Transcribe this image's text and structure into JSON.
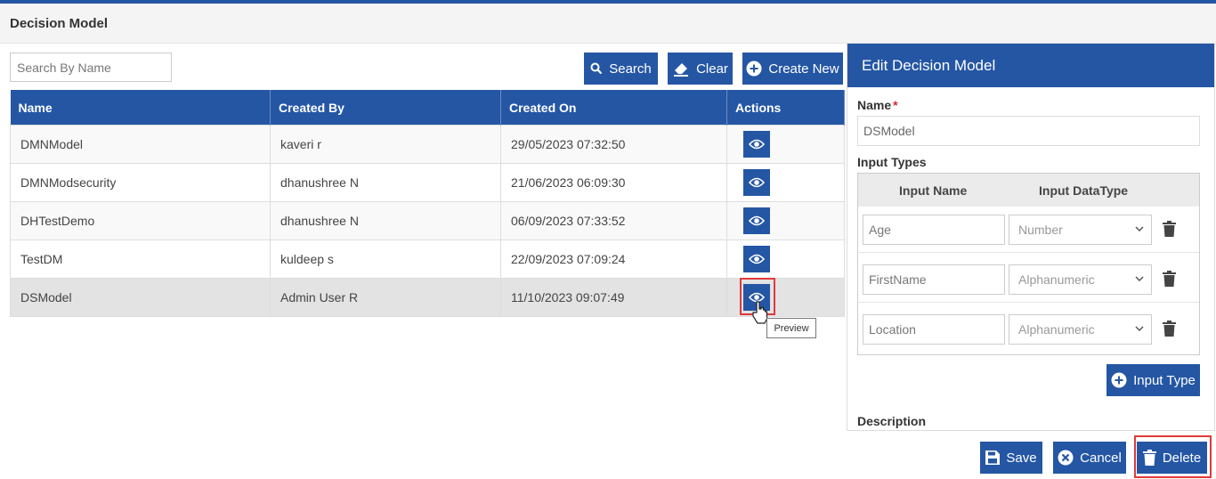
{
  "page": {
    "title": "Decision Model"
  },
  "toolbar": {
    "search_placeholder": "Search By Name",
    "search_label": "Search",
    "clear_label": "Clear",
    "create_label": "Create New"
  },
  "table": {
    "columns": [
      "Name",
      "Created By",
      "Created On",
      "Actions"
    ],
    "rows": [
      {
        "name": "DMNModel",
        "created_by": "kaveri r",
        "created_on": "29/05/2023 07:32:50"
      },
      {
        "name": "DMNModsecurity",
        "created_by": "dhanushree N",
        "created_on": "21/06/2023 06:09:30"
      },
      {
        "name": "DHTestDemo",
        "created_by": "dhanushree N",
        "created_on": "06/09/2023 07:33:52"
      },
      {
        "name": "TestDM",
        "created_by": "kuldeep s",
        "created_on": "22/09/2023 07:09:24"
      },
      {
        "name": "DSModel",
        "created_by": "Admin User R",
        "created_on": "11/10/2023 09:07:49"
      }
    ],
    "tooltip": "Preview"
  },
  "panel": {
    "title": "Edit Decision Model",
    "name_label": "Name",
    "name_required": "*",
    "name_value": "DSModel",
    "input_types_label": "Input Types",
    "col_input_name": "Input Name",
    "col_input_datatype": "Input DataType",
    "input_types": [
      {
        "name": "Age",
        "datatype": "Number"
      },
      {
        "name": "FirstName",
        "datatype": "Alphanumeric"
      },
      {
        "name": "Location",
        "datatype": "Alphanumeric"
      }
    ],
    "add_input_label": "Input Type",
    "description_label": "Description"
  },
  "footer": {
    "save_label": "Save",
    "cancel_label": "Cancel",
    "delete_label": "Delete"
  },
  "colors": {
    "primary": "#2456a4",
    "highlight": "#e03a3a",
    "required": "#d9232d"
  },
  "icons": [
    "search-icon",
    "eraser-icon",
    "plus-circle-icon",
    "eye-icon",
    "trash-icon",
    "save-icon",
    "cancel-icon",
    "delete-icon",
    "chevron-down-icon",
    "pointer-cursor-icon"
  ]
}
